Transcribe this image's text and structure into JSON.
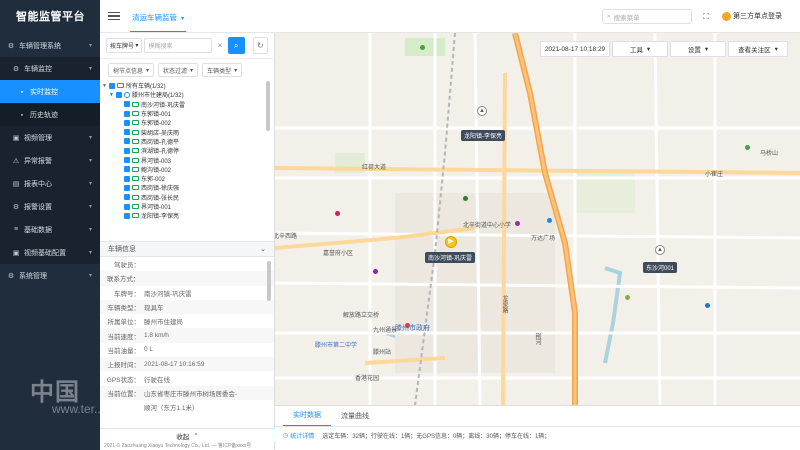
{
  "app": {
    "title": "智能监管平台"
  },
  "sidebar": {
    "items": [
      {
        "label": "车辆管理系统",
        "icon": "gear-icon",
        "level": 0,
        "active": false
      },
      {
        "label": "车辆监控",
        "icon": "gear-icon",
        "level": 1,
        "active": false
      },
      {
        "label": "实时监控",
        "icon": "dot-icon",
        "level": 2,
        "active": true
      },
      {
        "label": "历史轨迹",
        "icon": "dot-icon",
        "level": 2,
        "active": false
      },
      {
        "label": "视频管理",
        "icon": "video-icon",
        "level": 1,
        "active": false
      },
      {
        "label": "异常报警",
        "icon": "alarm-icon",
        "level": 1,
        "active": false
      },
      {
        "label": "报表中心",
        "icon": "report-icon",
        "level": 1,
        "active": false
      },
      {
        "label": "报警设置",
        "icon": "settings-icon",
        "level": 1,
        "active": false
      },
      {
        "label": "基础数据",
        "icon": "data-icon",
        "level": 1,
        "active": false
      },
      {
        "label": "视频基础配置",
        "icon": "video-config-icon",
        "level": 1,
        "active": false
      },
      {
        "label": "系统管理",
        "icon": "gear-icon",
        "level": 0,
        "active": false
      }
    ]
  },
  "topbar": {
    "active_tab": "清运车辆监管",
    "menu_search_placeholder": "搜索菜单",
    "user": "第三方单点登录"
  },
  "search": {
    "plate_select": "按车牌号",
    "placeholder": "模糊搜索"
  },
  "filters": [
    "树节点信息",
    "状态过滤",
    "车辆类型"
  ],
  "tree": {
    "root": "所有车辆(1/32)",
    "org": "滕州市住建局(1/32)",
    "vehicles": [
      "南沙河镇-巩庆雷",
      "东郭镇-001",
      "东郭镇-002",
      "柴胡店-吴庆雨",
      "西岗镇-孔德平",
      "滨湖镇-孔德停",
      "界河镇-003",
      "鲍沟镇-002",
      "东郭-002",
      "西岗镇-徐庆强",
      "西岗镇-张长民",
      "界河镇-001",
      "龙阳镇-李保亮"
    ]
  },
  "vehicle_info": {
    "header": "车辆信息",
    "rows": [
      {
        "k": "驾驶员：",
        "v": ""
      },
      {
        "k": "联系方式：",
        "v": "",
        "section": true
      },
      {
        "k": "车牌号：",
        "v": "南沙河镇-巩庆雷"
      },
      {
        "k": "车辆类型：",
        "v": "现具车"
      },
      {
        "k": "所属单位：",
        "v": "滕州市住建局"
      },
      {
        "k": "当前速度：",
        "v": "1.8 km/h"
      },
      {
        "k": "当前油量：",
        "v": "0 L"
      },
      {
        "k": "上报时间：",
        "v": "2021-08-17 10:16:59"
      },
      {
        "k": "GPS状态：",
        "v": "行驶在线"
      },
      {
        "k": "当前位置：",
        "v": "山东省枣庄市滕州市树场居委会-"
      },
      {
        "k": "",
        "v": "顺河（东方1.1米）"
      }
    ]
  },
  "collapse_label": "收起",
  "footer": "2021 © Zaozhuang Xiaoyu Technology Co., Ltd. — 鲁ICP备xxxx号",
  "map": {
    "datetime": "2021-08-17 10:18:29",
    "tools_label": "工具",
    "settings_label": "设置",
    "view_label": "查看关注区",
    "labels": [
      {
        "text": "红荷大道",
        "cls": "road"
      },
      {
        "text": "北辛西路",
        "cls": "road"
      },
      {
        "text": "龙泉路",
        "cls": "road"
      },
      {
        "text": "滕州市政府",
        "cls": "poi"
      },
      {
        "text": "滕州市第二中学",
        "cls": "poi"
      },
      {
        "text": "滕州站",
        "cls": "poi"
      },
      {
        "text": "北辛街道中心小学",
        "cls": "poi"
      },
      {
        "text": "嘉誉府小区",
        "cls": "poi"
      },
      {
        "text": "九州通景",
        "cls": "poi"
      },
      {
        "text": "解放路立交桥",
        "cls": "poi"
      },
      {
        "text": "香港花园",
        "cls": "poi"
      },
      {
        "text": "马桥山",
        "cls": "poi"
      },
      {
        "text": "小崔庄",
        "cls": "poi"
      },
      {
        "text": "万达广场",
        "cls": "poi"
      },
      {
        "text": "荆河",
        "cls": "poi"
      }
    ],
    "cars": [
      {
        "label": "龙阳镇-李保亮"
      },
      {
        "label": "南沙河镇-巩庆雷"
      },
      {
        "label": "东沙河001"
      }
    ]
  },
  "bottom": {
    "tabs": [
      "实时数据",
      "流量曲线"
    ],
    "stats_link": "统计详情",
    "stats_text": "选定车辆：32辆；行驶在线：1辆；无GPS信息：0辆；离线：30辆；停车在线：1辆；"
  },
  "watermark": {
    "main": "中国",
    "sub": "www.ter..."
  }
}
